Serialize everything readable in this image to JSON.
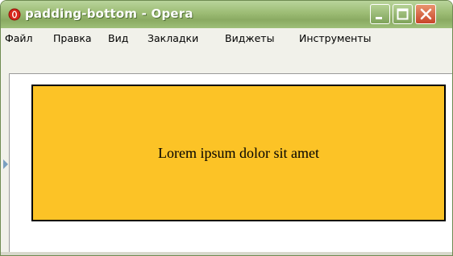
{
  "window": {
    "title": "padding-bottom - Opera",
    "app_icon": "opera-icon"
  },
  "title_buttons": {
    "minimize_icon": "minimize-icon",
    "maximize_icon": "maximize-icon",
    "close_icon": "close-icon"
  },
  "menu": {
    "items": [
      {
        "label": "Файл"
      },
      {
        "label": "Правка"
      },
      {
        "label": "Вид"
      },
      {
        "label": "Закладки"
      },
      {
        "label": "Виджеты"
      },
      {
        "label": "Инструменты"
      }
    ]
  },
  "page": {
    "box_text": "Lorem ipsum dolor sit amet",
    "box_color": "#fcc326",
    "box_border_color": "#000000"
  },
  "colors": {
    "titlebar": "#9cbc74",
    "close_button": "#c8452a",
    "frame": "#f1f1ea"
  }
}
